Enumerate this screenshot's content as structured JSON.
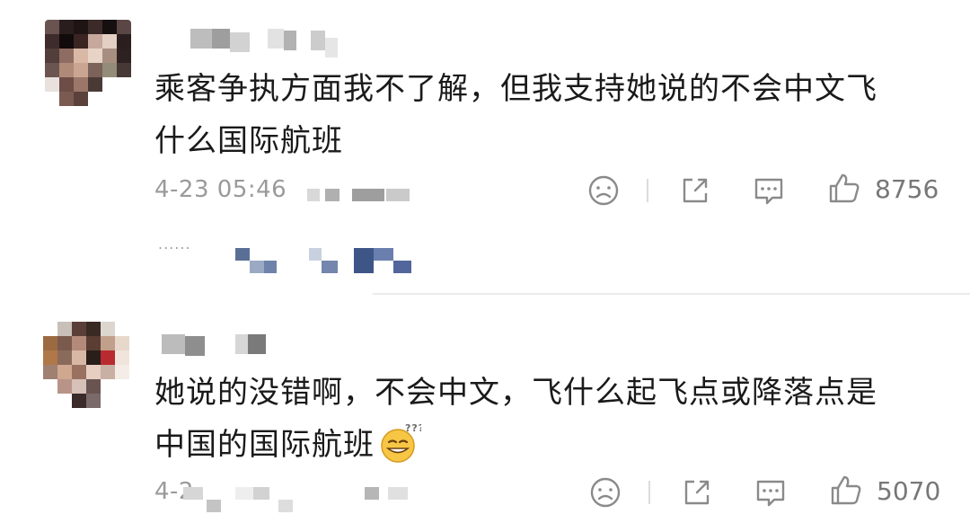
{
  "comments": [
    {
      "text_line1": "乘客争执方面我不了解，但我支持她说的不会中文飞",
      "text_line2": "什么国际航班",
      "timestamp": "4-23 05:46",
      "like_count": "8756",
      "icons": [
        "dislike-face-icon",
        "share-icon",
        "reply-icon",
        "thumbs-up-icon"
      ]
    },
    {
      "text_line1": "她说的没错啊，不会中文，飞什么起飞点或降落点是",
      "text_line2": "中国的国际航班",
      "timestamp": "4-2",
      "like_count": "5070",
      "icons": [
        "dislike-face-icon",
        "share-icon",
        "reply-icon",
        "thumbs-up-icon"
      ]
    }
  ],
  "reply_preview": "......"
}
